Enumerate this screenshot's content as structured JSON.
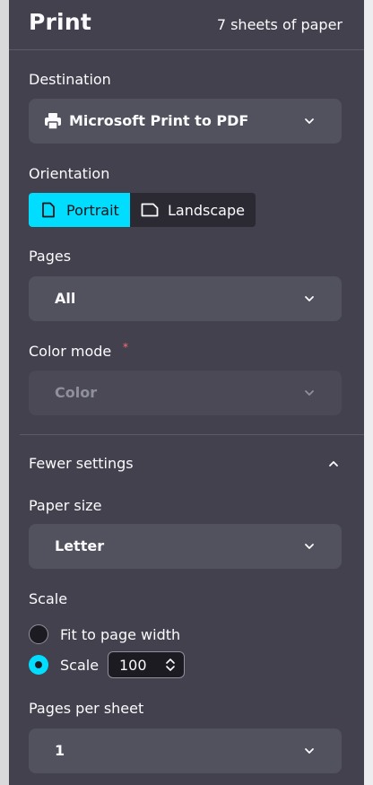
{
  "header": {
    "title": "Print",
    "sheets": "7 sheets of paper"
  },
  "destination": {
    "label": "Destination",
    "value": "Microsoft Print to PDF"
  },
  "orientation": {
    "label": "Orientation",
    "options": [
      "Portrait",
      "Landscape"
    ],
    "selected": "Portrait"
  },
  "pages": {
    "label": "Pages",
    "value": "All"
  },
  "color_mode": {
    "label": "Color mode",
    "required_mark": "*",
    "value": "Color",
    "disabled": true
  },
  "settings_toggle": {
    "label": "Fewer settings"
  },
  "paper_size": {
    "label": "Paper size",
    "value": "Letter"
  },
  "scale": {
    "label": "Scale",
    "fit_label": "Fit to page width",
    "scale_label": "Scale",
    "scale_value": "100",
    "selected": "Scale"
  },
  "pages_per_sheet": {
    "label": "Pages per sheet",
    "value": "1"
  },
  "colors": {
    "panel": "#42414d",
    "control": "#52525e",
    "accent": "#00ddff",
    "text": "#fbfbfe"
  },
  "icons": {
    "printer": "printer-icon",
    "chevron": "chevron-down-icon",
    "portrait": "portrait-page-icon",
    "landscape": "landscape-page-icon"
  }
}
